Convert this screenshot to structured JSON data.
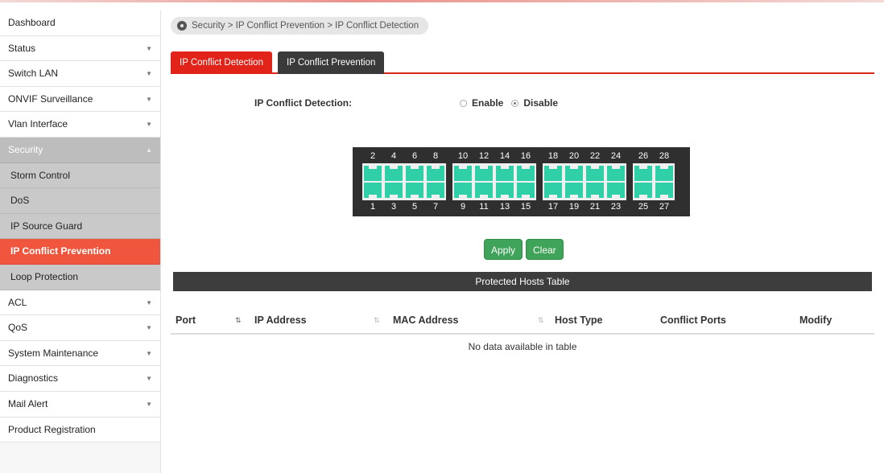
{
  "sidebar": {
    "items": [
      {
        "label": "Dashboard",
        "chevron": false
      },
      {
        "label": "Status",
        "chevron": true
      },
      {
        "label": "Switch LAN",
        "chevron": true
      },
      {
        "label": "ONVIF Surveillance",
        "chevron": true
      },
      {
        "label": "Vlan Interface",
        "chevron": true
      },
      {
        "label": "Security",
        "chevron": true
      },
      {
        "label": "Storm Control"
      },
      {
        "label": "DoS"
      },
      {
        "label": "IP Source Guard"
      },
      {
        "label": "IP Conflict Prevention"
      },
      {
        "label": "Loop Protection"
      },
      {
        "label": "ACL",
        "chevron": true
      },
      {
        "label": "QoS",
        "chevron": true
      },
      {
        "label": "System Maintenance",
        "chevron": true
      },
      {
        "label": "Diagnostics",
        "chevron": true
      },
      {
        "label": "Mail Alert",
        "chevron": true
      },
      {
        "label": "Product Registration",
        "chevron": false
      }
    ]
  },
  "breadcrumb": {
    "icon": "location-pin-icon",
    "text": "Security > IP Conflict Prevention  > IP Conflict Detection"
  },
  "tabs": [
    {
      "label": "IP Conflict Detection"
    },
    {
      "label": "IP Conflict Prevention"
    }
  ],
  "form": {
    "label": "IP Conflict Detection:",
    "options": [
      "Enable",
      "Disable"
    ],
    "selected": "Disable"
  },
  "switch": {
    "top_ports": [
      "2",
      "4",
      "6",
      "8",
      "10",
      "12",
      "14",
      "16",
      "18",
      "20",
      "22",
      "24",
      "26",
      "28"
    ],
    "bottom_ports": [
      "1",
      "3",
      "5",
      "7",
      "9",
      "11",
      "13",
      "15",
      "17",
      "19",
      "21",
      "23",
      "25",
      "27"
    ]
  },
  "buttons": {
    "apply": "Apply",
    "clear": "Clear"
  },
  "table": {
    "title": "Protected Hosts Table",
    "columns": [
      "Port",
      "IP Address",
      "MAC Address",
      "Host Type",
      "Conflict Ports",
      "Modify"
    ],
    "empty_text": "No data available in table"
  },
  "colors": {
    "accent": "#e2231a",
    "port": "#2fcfa8",
    "button": "#3fa35a",
    "selected_nav": "#f0553d"
  }
}
